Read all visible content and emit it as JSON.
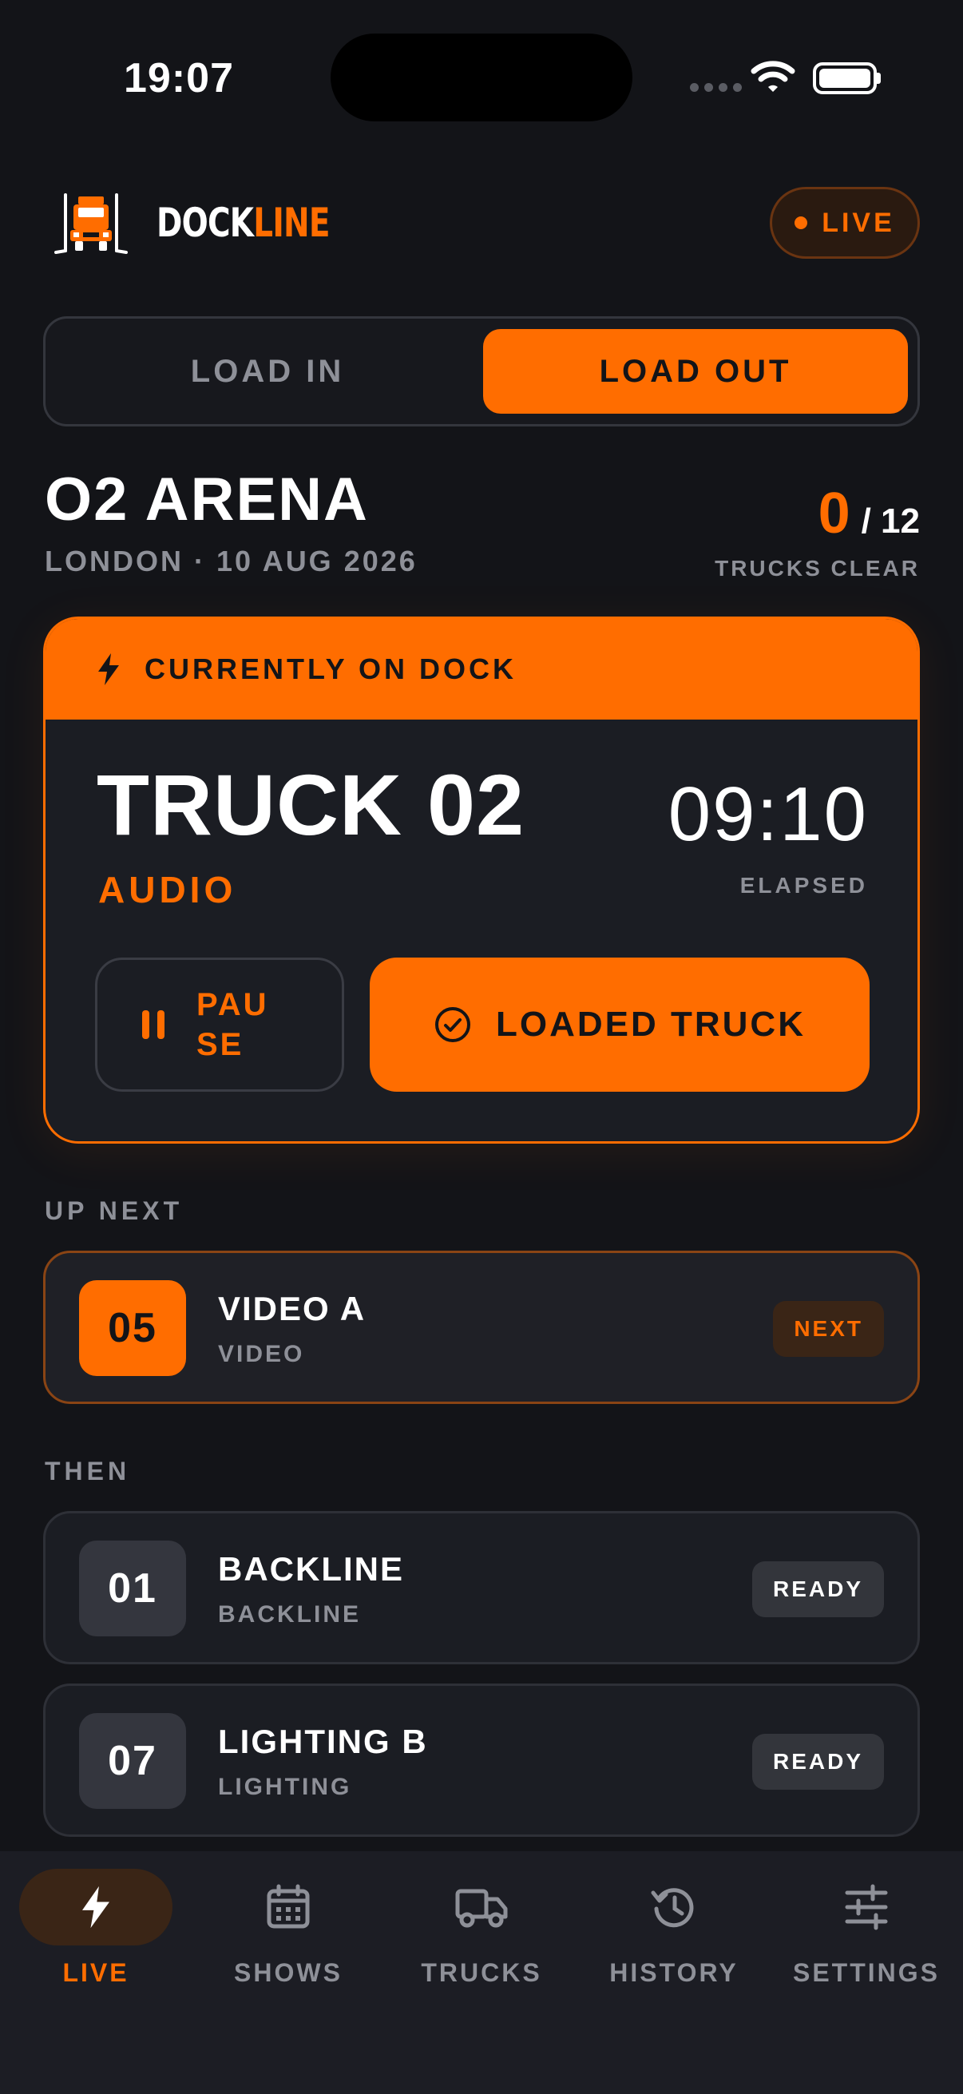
{
  "status_bar": {
    "time": "19:07"
  },
  "header": {
    "brand_part1": "DOCK",
    "brand_part2": "LINE",
    "live_label": "LIVE"
  },
  "mode_toggle": {
    "options": [
      "LOAD IN",
      "LOAD OUT"
    ],
    "selected": "LOAD OUT"
  },
  "venue": {
    "name": "O2 ARENA",
    "subtitle": "LONDON · 10 AUG 2026",
    "trucks_clear": "0",
    "trucks_total": "/ 12",
    "trucks_label": "TRUCKS CLEAR"
  },
  "dock": {
    "header_label": "CURRENTLY ON DOCK",
    "truck": "TRUCK 02",
    "department": "AUDIO",
    "timer": "09:10",
    "timer_label": "ELAPSED",
    "pause_label": "PAUSE",
    "loaded_label": "LOADED TRUCK"
  },
  "up_next": {
    "label": "UP NEXT",
    "item": {
      "number": "05",
      "title": "VIDEO A",
      "subtitle": "VIDEO",
      "badge": "NEXT"
    }
  },
  "then": {
    "label": "THEN",
    "items": [
      {
        "number": "01",
        "title": "BACKLINE",
        "subtitle": "BACKLINE",
        "badge": "READY"
      },
      {
        "number": "07",
        "title": "LIGHTING B",
        "subtitle": "LIGHTING",
        "badge": "READY"
      }
    ]
  },
  "tabbar": {
    "tabs": [
      {
        "label": "LIVE",
        "icon": "bolt-icon"
      },
      {
        "label": "SHOWS",
        "icon": "calendar-icon"
      },
      {
        "label": "TRUCKS",
        "icon": "truck-icon"
      },
      {
        "label": "HISTORY",
        "icon": "history-icon"
      },
      {
        "label": "SETTINGS",
        "icon": "sliders-icon"
      }
    ],
    "active": "LIVE"
  },
  "colors": {
    "accent": "#ff6d00",
    "background": "#131418",
    "card": "#1b1d23",
    "muted": "#8e9098"
  }
}
